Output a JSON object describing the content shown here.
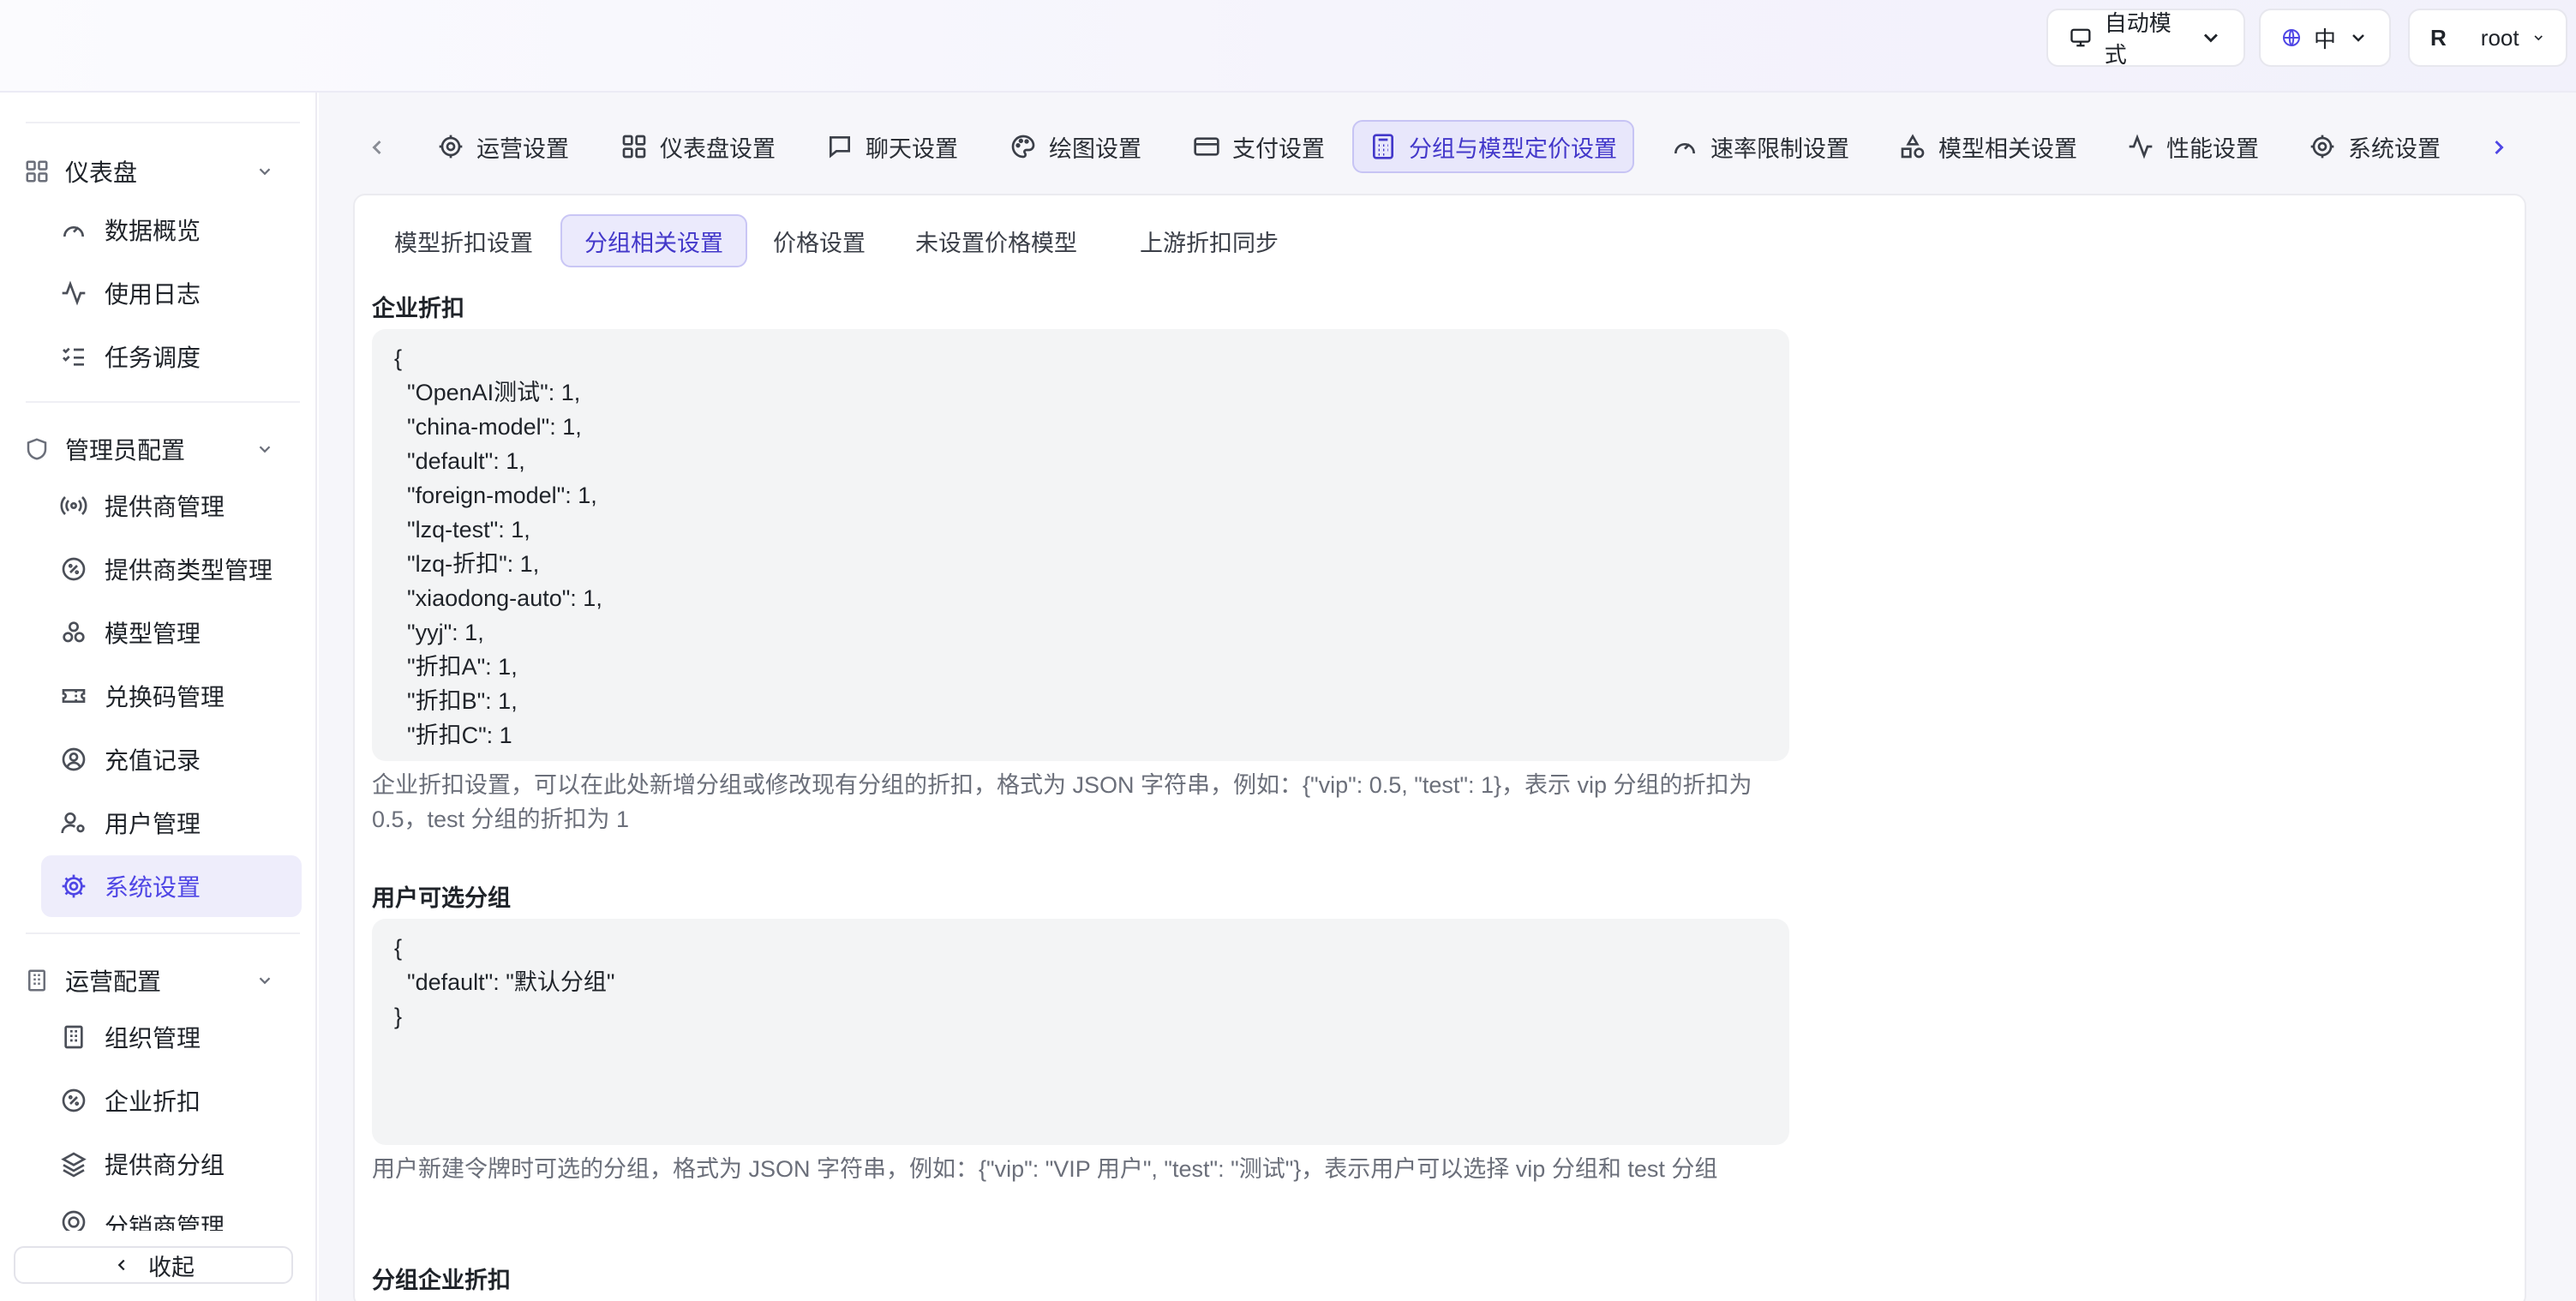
{
  "header": {
    "theme_label": "自动模式",
    "lang_label": "中",
    "user_initial": "R",
    "user_name": "root"
  },
  "sidebar": {
    "groups": [
      {
        "label": "仪表盘",
        "items": [
          {
            "label": "数据概览",
            "icon": "gauge-icon"
          },
          {
            "label": "使用日志",
            "icon": "activity-icon"
          },
          {
            "label": "任务调度",
            "icon": "checklist-icon"
          }
        ]
      },
      {
        "label": "管理员配置",
        "items": [
          {
            "label": "提供商管理",
            "icon": "radio-tower-icon"
          },
          {
            "label": "提供商类型管理",
            "icon": "badge-percent-icon"
          },
          {
            "label": "模型管理",
            "icon": "boxes-icon"
          },
          {
            "label": "兑换码管理",
            "icon": "ticket-icon"
          },
          {
            "label": "充值记录",
            "icon": "user-circle-icon"
          },
          {
            "label": "用户管理",
            "icon": "user-cog-icon"
          },
          {
            "label": "系统设置",
            "icon": "gear-icon",
            "active": true
          }
        ]
      },
      {
        "label": "运营配置",
        "items": [
          {
            "label": "组织管理",
            "icon": "building-icon"
          },
          {
            "label": "企业折扣",
            "icon": "badge-percent-icon"
          },
          {
            "label": "提供商分组",
            "icon": "layers-icon"
          },
          {
            "label": "分销商管理",
            "icon": "target-icon"
          }
        ]
      }
    ],
    "collapse_label": "收起"
  },
  "tabs": [
    {
      "label": "运营设置",
      "icon": "gear-icon"
    },
    {
      "label": "仪表盘设置",
      "icon": "grid-icon"
    },
    {
      "label": "聊天设置",
      "icon": "chat-icon"
    },
    {
      "label": "绘图设置",
      "icon": "palette-icon"
    },
    {
      "label": "支付设置",
      "icon": "credit-card-icon"
    },
    {
      "label": "分组与模型定价设置",
      "icon": "calculator-icon",
      "active": true
    },
    {
      "label": "速率限制设置",
      "icon": "gauge-icon"
    },
    {
      "label": "模型相关设置",
      "icon": "shapes-icon"
    },
    {
      "label": "性能设置",
      "icon": "activity-icon"
    },
    {
      "label": "系统设置",
      "icon": "gear-icon"
    }
  ],
  "subtabs": [
    {
      "label": "模型折扣设置"
    },
    {
      "label": "分组相关设置",
      "active": true
    },
    {
      "label": "价格设置"
    },
    {
      "label": "未设置价格模型"
    },
    {
      "label": "上游折扣同步"
    }
  ],
  "sections": {
    "enterprise": {
      "title": "企业折扣",
      "lines": [
        "{",
        "  \"OpenAI测试\": 1,",
        "  \"china-model\": 1,",
        "  \"default\": 1,",
        "  \"foreign-model\": 1,",
        "  \"lzq-test\": 1,",
        "  \"lzq-折扣\": 1,",
        "  \"xiaodong-auto\": 1,",
        "  \"yyj\": 1,",
        "  \"折扣A\": 1,",
        "  \"折扣B\": 1,",
        "  \"折扣C\": 1"
      ],
      "hint": "企业折扣设置，可以在此处新增分组或修改现有分组的折扣，格式为 JSON 字符串，例如：{\"vip\": 0.5, \"test\": 1}，表示 vip 分组的折扣为 0.5，test 分组的折扣为 1"
    },
    "user_groups": {
      "title": "用户可选分组",
      "lines": [
        "{",
        "  \"default\": \"默认分组\"",
        "}"
      ],
      "hint": "用户新建令牌时可选的分组，格式为 JSON 字符串，例如：{\"vip\": \"VIP 用户\", \"test\": \"测试\"}，表示用户可以选择 vip 分组和 test 分组"
    },
    "group_enterprise": {
      "title": "分组企业折扣"
    }
  }
}
